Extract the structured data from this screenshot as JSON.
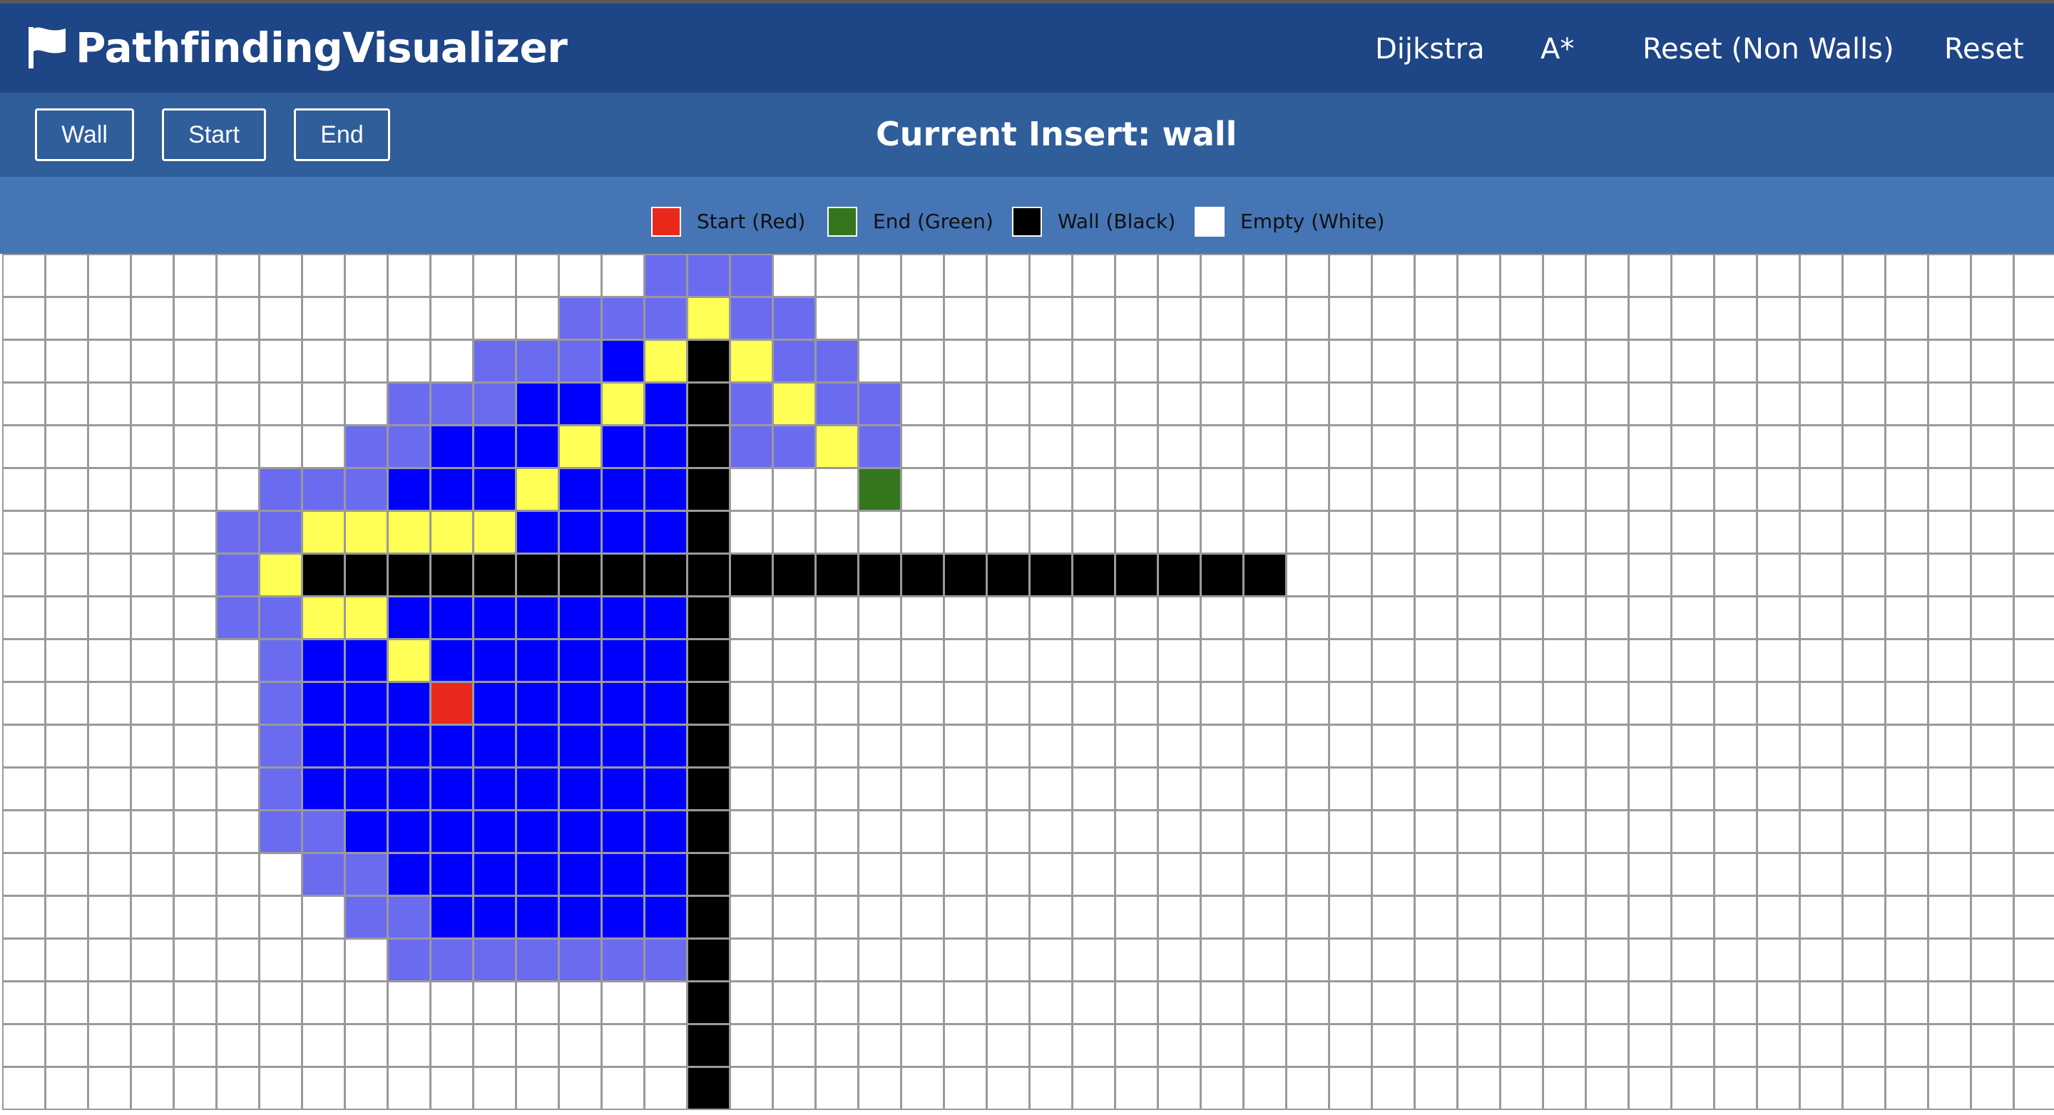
{
  "app": {
    "brand": "PathfindingVisualizer",
    "brand_icon": "flag-icon"
  },
  "nav": {
    "items": [
      {
        "label": "Dijkstra"
      },
      {
        "label": "A*"
      },
      {
        "label": "Reset (Non Walls)"
      },
      {
        "label": "Reset"
      }
    ]
  },
  "toolbar": {
    "buttons": [
      {
        "label": "Wall"
      },
      {
        "label": "Start"
      },
      {
        "label": "End"
      }
    ],
    "current_insert": "Current Insert: wall"
  },
  "legend": {
    "items": [
      {
        "label": "Start (Red)",
        "color": "#e8291c"
      },
      {
        "label": "End (Green)",
        "color": "#34761e"
      },
      {
        "label": "Wall (Black)",
        "color": "#000000"
      },
      {
        "label": "Empty (White)",
        "color": "#ffffff"
      }
    ]
  },
  "colors": {
    "navbar": "#1e4585",
    "toolbar": "#2f5e9a",
    "legend_bar": "#4575b4",
    "wall": "#000000",
    "visited": "#0000ff",
    "frontier": "#6b6bf0",
    "path": "#ffff55",
    "start": "#e8291c",
    "end": "#34761e",
    "empty": "#ffffff"
  },
  "grid": {
    "visible_cols": 48,
    "visible_rows": 20,
    "legend_codes": {
      "W": "wall",
      "B": "visited",
      "L": "frontier",
      "Y": "path",
      "S": "start",
      "E": "end",
      ".": "empty"
    },
    "rows": [
      "...............LLL..............................",
      ".............LLLYLL.............................",
      "...........LLLBYWYLL............................",
      ".........LLLBBYBWLYLL...........................",
      "........LLBBBYBBWLLYL...........................",
      "......LLLBBBYBBBW...E...........................",
      ".....LLYYYYYBBBBW...............................",
      ".....LYWWWWWWWWWWWWWWWWWWWWWWW..................",
      ".....LLYYBBBBBBBW...............................",
      "......LBBYBBBBBBW...............................",
      "......LBBBSBBBBBW...............................",
      "......LBBBBBBBBBW...............................",
      "......LBBBBBBBBBW...............................",
      "......LLBBBBBBBBW...............................",
      ".......LLBBBBBBBW...............................",
      "........LLBBBBBBW...............................",
      ".........LLLLLLLW...............................",
      "................W...............................",
      "................W...............................",
      "................W..............................."
    ]
  }
}
